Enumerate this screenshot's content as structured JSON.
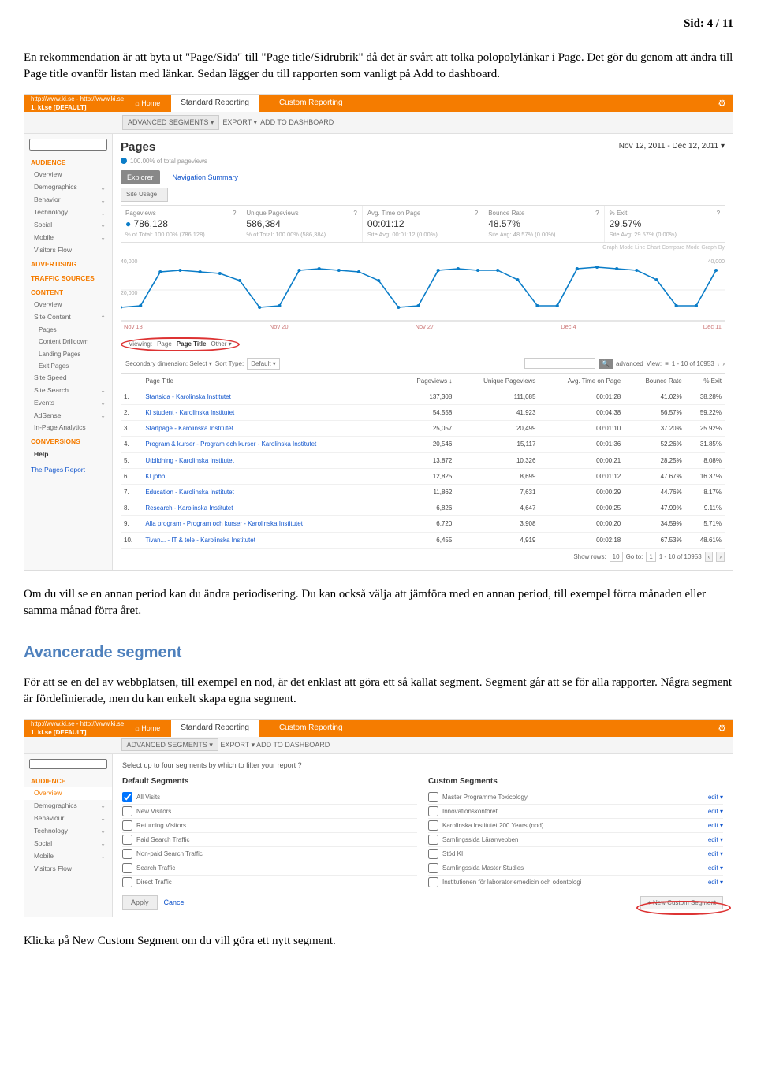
{
  "page_number": "Sid: 4 / 11",
  "intro_para": "En rekommendation är att byta ut \"Page/Sida\" till \"Page title/Sidrubrik\" då det är svårt att tolka polopolylänkar i Page. Det gör du genom att ändra till Page title ovanför listan med länkar. Sedan lägger du till rapporten som vanligt på Add to dashboard.",
  "mid_para": "Om du vill se en annan period kan du ändra periodisering. Du kan också välja att jämföra med en annan period, till exempel förra månaden eller samma månad förra året.",
  "adv_heading": "Avancerade segment",
  "adv_para": "För att se en del av webbplatsen, till exempel en nod, är det enklast att göra ett så kallat segment. Segment går att se för alla rapporter. Några segment är fördefinierade, men du kan enkelt skapa egna segment.",
  "outro_para": "Klicka på New Custom Segment om du vill göra ett nytt segment.",
  "ga": {
    "crumb": "http://www.ki.se - http://www.ki.se",
    "profile": "1. ki.se [DEFAULT]",
    "nav_home": "Home",
    "nav_standard": "Standard Reporting",
    "nav_custom": "Custom Reporting",
    "sub_advseg": "ADVANCED SEGMENTS ▾",
    "sub_export": "EXPORT ▾",
    "sub_add": "ADD TO DASHBOARD",
    "sidebar": {
      "audience": "AUDIENCE",
      "items_a": [
        "Overview",
        "Demographics",
        "Behavior",
        "Technology",
        "Social",
        "Mobile",
        "Visitors Flow"
      ],
      "advertising": "ADVERTISING",
      "traffic": "TRAFFIC SOURCES",
      "content": "CONTENT",
      "items_c": [
        "Overview",
        "Site Content"
      ],
      "items_c_sub": [
        "Pages",
        "Content Drilldown",
        "Landing Pages",
        "Exit Pages"
      ],
      "items_c2": [
        "Site Speed",
        "Site Search",
        "Events",
        "AdSense",
        "In-Page Analytics"
      ],
      "conversions": "CONVERSIONS",
      "help": "Help",
      "help_link": "The Pages Report"
    },
    "page_title": "Pages",
    "totals": "100.00% of total pageviews",
    "date_range": "Nov 12, 2011 - Dec 12, 2011",
    "tab_explorer": "Explorer",
    "tab_navsum": "Navigation Summary",
    "site_usage": "Site Usage",
    "metrics": [
      {
        "label": "Pageviews",
        "value": "786,128",
        "sub": "% of Total: 100.00% (786,128)"
      },
      {
        "label": "Unique Pageviews",
        "value": "586,384",
        "sub": "% of Total: 100.00% (586,384)"
      },
      {
        "label": "Avg. Time on Page",
        "value": "00:01:12",
        "sub": "Site Avg: 00:01:12 (0.00%)"
      },
      {
        "label": "Bounce Rate",
        "value": "48.57%",
        "sub": "Site Avg: 48.57% (0.00%)"
      },
      {
        "label": "% Exit",
        "value": "29.57%",
        "sub": "Site Avg: 29.57% (0.00%)"
      }
    ],
    "chart_info": "?",
    "axis_labels": [
      "Nov 13",
      "Nov 20",
      "Nov 27",
      "Dec 4",
      "Dec 11"
    ],
    "y_top": "40,000",
    "y_top2": "40,000",
    "y_mid": "20,000",
    "view_tabs": {
      "viewing": "Viewing:",
      "p": "Page",
      "pt": "Page Title",
      "o": "Other ▾"
    },
    "filter": {
      "sec": "Secondary dimension: Select ▾",
      "sort": "Sort Type:",
      "def": "Default ▾",
      "adv": "advanced",
      "view": "View:",
      "range": "1 - 10 of 10953"
    },
    "table": {
      "headers": [
        "",
        "Page Title",
        "Pageviews",
        "Unique Pageviews",
        "Avg. Time on Page",
        "Bounce Rate",
        "% Exit"
      ],
      "rows": [
        [
          "1.",
          "Startsida - Karolinska Institutet",
          "137,308",
          "111,085",
          "00:01:28",
          "41.02%",
          "38.28%"
        ],
        [
          "2.",
          "KI student - Karolinska Institutet",
          "54,558",
          "41,923",
          "00:04:38",
          "56.57%",
          "59.22%"
        ],
        [
          "3.",
          "Startpage - Karolinska Institutet",
          "25,057",
          "20,499",
          "00:01:10",
          "37.20%",
          "25.92%"
        ],
        [
          "4.",
          "Program & kurser - Program och kurser - Karolinska Institutet",
          "20,546",
          "15,117",
          "00:01:36",
          "52.26%",
          "31.85%"
        ],
        [
          "5.",
          "Utbildning - Karolinska Institutet",
          "13,872",
          "10,326",
          "00:00:21",
          "28.25%",
          "8.08%"
        ],
        [
          "6.",
          "KI jobb",
          "12,825",
          "8,699",
          "00:01:12",
          "47.67%",
          "16.37%"
        ],
        [
          "7.",
          "Education - Karolinska Institutet",
          "11,862",
          "7,631",
          "00:00:29",
          "44.76%",
          "8.17%"
        ],
        [
          "8.",
          "Research - Karolinska Institutet",
          "6,826",
          "4,647",
          "00:00:25",
          "47.99%",
          "9.11%"
        ],
        [
          "9.",
          "Alla program - Program och kurser - Karolinska Institutet",
          "6,720",
          "3,908",
          "00:00:20",
          "34.59%",
          "5.71%"
        ],
        [
          "10.",
          "Tivan... - IT & tele - Karolinska Institutet",
          "6,455",
          "4,919",
          "00:02:18",
          "67.53%",
          "48.61%"
        ]
      ]
    },
    "pager": {
      "show": "Show rows:",
      "ten": "10",
      "goto": "Go to:",
      "one": "1",
      "range": "1 - 10 of 10953"
    },
    "graph_right": "Graph Mode   Line Chart     Compare Mode   Graph By"
  },
  "ga2": {
    "prompt": "Select up to four segments by which to filter your report",
    "default_h": "Default Segments",
    "custom_h": "Custom Segments",
    "defaults": [
      "All Visits",
      "New Visitors",
      "Returning Visitors",
      "Paid Search Traffic",
      "Non-paid Search Traffic",
      "Search Traffic",
      "Direct Traffic"
    ],
    "customs": [
      "Master Programme Toxicology",
      "Innovationskontoret",
      "Karolinska Institutet 200 Years (nod)",
      "Samlingssida Lärarwebben",
      "Stöd KI",
      "Samlingssida Master Studies",
      "Institutionen för laboratoriemedicin och odontologi"
    ],
    "edit": "edit",
    "apply": "Apply",
    "cancel": "Cancel",
    "newseg": "+ New Custom Segment",
    "sidebar2": {
      "audience": "AUDIENCE",
      "items": [
        "Overview",
        "Demographics",
        "Behaviour",
        "Technology",
        "Social",
        "Mobile",
        "Visitors Flow"
      ]
    }
  },
  "chart_data": {
    "type": "line",
    "title": "Pageviews",
    "xlabel": "",
    "ylabel": "Pageviews",
    "ylim": [
      0,
      40000
    ],
    "x": [
      "Nov 12",
      "Nov 13",
      "Nov 14",
      "Nov 15",
      "Nov 16",
      "Nov 17",
      "Nov 18",
      "Nov 19",
      "Nov 20",
      "Nov 21",
      "Nov 22",
      "Nov 23",
      "Nov 24",
      "Nov 25",
      "Nov 26",
      "Nov 27",
      "Nov 28",
      "Nov 29",
      "Nov 30",
      "Dec 1",
      "Dec 2",
      "Dec 3",
      "Dec 4",
      "Dec 5",
      "Dec 6",
      "Dec 7",
      "Dec 8",
      "Dec 9",
      "Dec 10",
      "Dec 11",
      "Dec 12"
    ],
    "series": [
      {
        "name": "Pageviews",
        "values": [
          9000,
          10000,
          32000,
          33000,
          32000,
          31000,
          26000,
          9000,
          10000,
          33000,
          34000,
          33000,
          32000,
          26000,
          9000,
          10000,
          33000,
          34000,
          33000,
          33000,
          27000,
          10000,
          10000,
          34000,
          35000,
          34000,
          33000,
          27000,
          10000,
          10000,
          33000
        ]
      }
    ]
  }
}
